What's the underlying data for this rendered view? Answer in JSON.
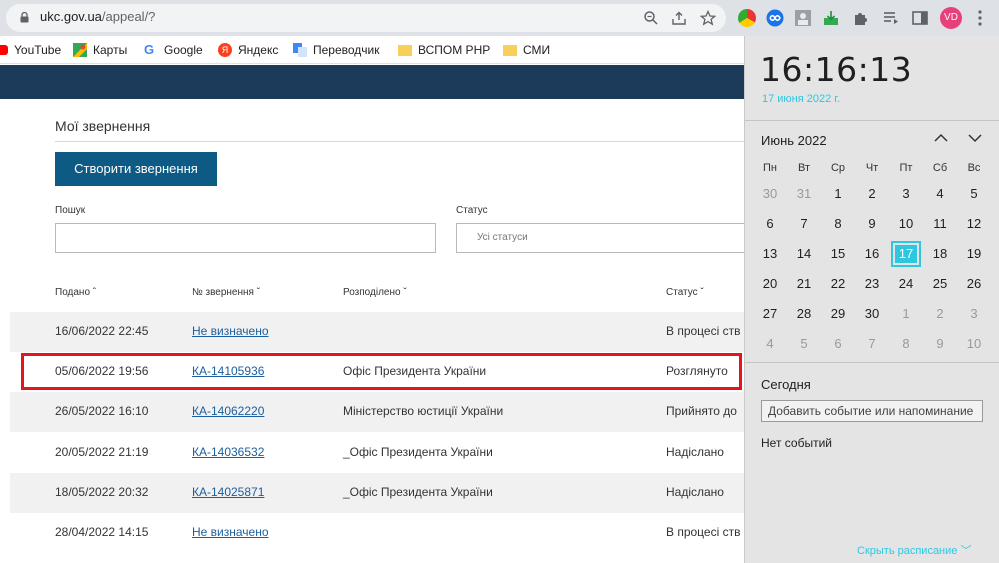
{
  "browser": {
    "url_host": "ukc.gov.ua",
    "url_path": "/appeal/?",
    "avatar_initials": "VD",
    "bookmarks": [
      "YouTube",
      "Карты",
      "Google",
      "Яндекс",
      "Переводчик",
      "ВСПОМ РНР",
      "СМИ"
    ]
  },
  "page": {
    "title": "Мої звернення",
    "create_button": "Створити звернення",
    "search_label": "Пошук",
    "status_label": "Статус",
    "status_value": "Усі статуси",
    "headers": [
      "Подано",
      "№ звернення",
      "Розподілено",
      "Статус"
    ],
    "rows": [
      {
        "date": "16/06/2022 22:45",
        "number": "Не визначено",
        "assigned": "",
        "status": "В процесі ств"
      },
      {
        "date": "05/06/2022 19:56",
        "number": "КА-14105936",
        "assigned": "Офіс Президента України",
        "status": "Розглянуто"
      },
      {
        "date": "26/05/2022 16:10",
        "number": "КА-14062220",
        "assigned": "Міністерство юстиції України",
        "status": "Прийнято до"
      },
      {
        "date": "20/05/2022 21:19",
        "number": "КА-14036532",
        "assigned": "_Офіс Президента України",
        "status": "Надіслано"
      },
      {
        "date": "18/05/2022 20:32",
        "number": "КА-14025871",
        "assigned": "_Офіс Президента України",
        "status": "Надіслано"
      },
      {
        "date": "28/04/2022 14:15",
        "number": "Не визначено",
        "assigned": "",
        "status": "В процесі ств"
      }
    ]
  },
  "calendar": {
    "time": "16:16:13",
    "date": "17 июня 2022 г.",
    "month": "Июнь 2022",
    "weekdays": [
      "Пн",
      "Вт",
      "Ср",
      "Чт",
      "Пт",
      "Сб",
      "Вс"
    ],
    "weeks": [
      [
        "30",
        "31",
        "1",
        "2",
        "3",
        "4",
        "5"
      ],
      [
        "6",
        "7",
        "8",
        "9",
        "10",
        "11",
        "12"
      ],
      [
        "13",
        "14",
        "15",
        "16",
        "17",
        "18",
        "19"
      ],
      [
        "20",
        "21",
        "22",
        "23",
        "24",
        "25",
        "26"
      ],
      [
        "27",
        "28",
        "29",
        "30",
        "1",
        "2",
        "3"
      ],
      [
        "4",
        "5",
        "6",
        "7",
        "8",
        "9",
        "10"
      ]
    ],
    "today_label": "Сегодня",
    "add_event": "Добавить событие или напоминание",
    "no_events": "Нет событий",
    "hide_schedule": "Скрыть расписание",
    "accent_color": "#2fc7e0"
  }
}
